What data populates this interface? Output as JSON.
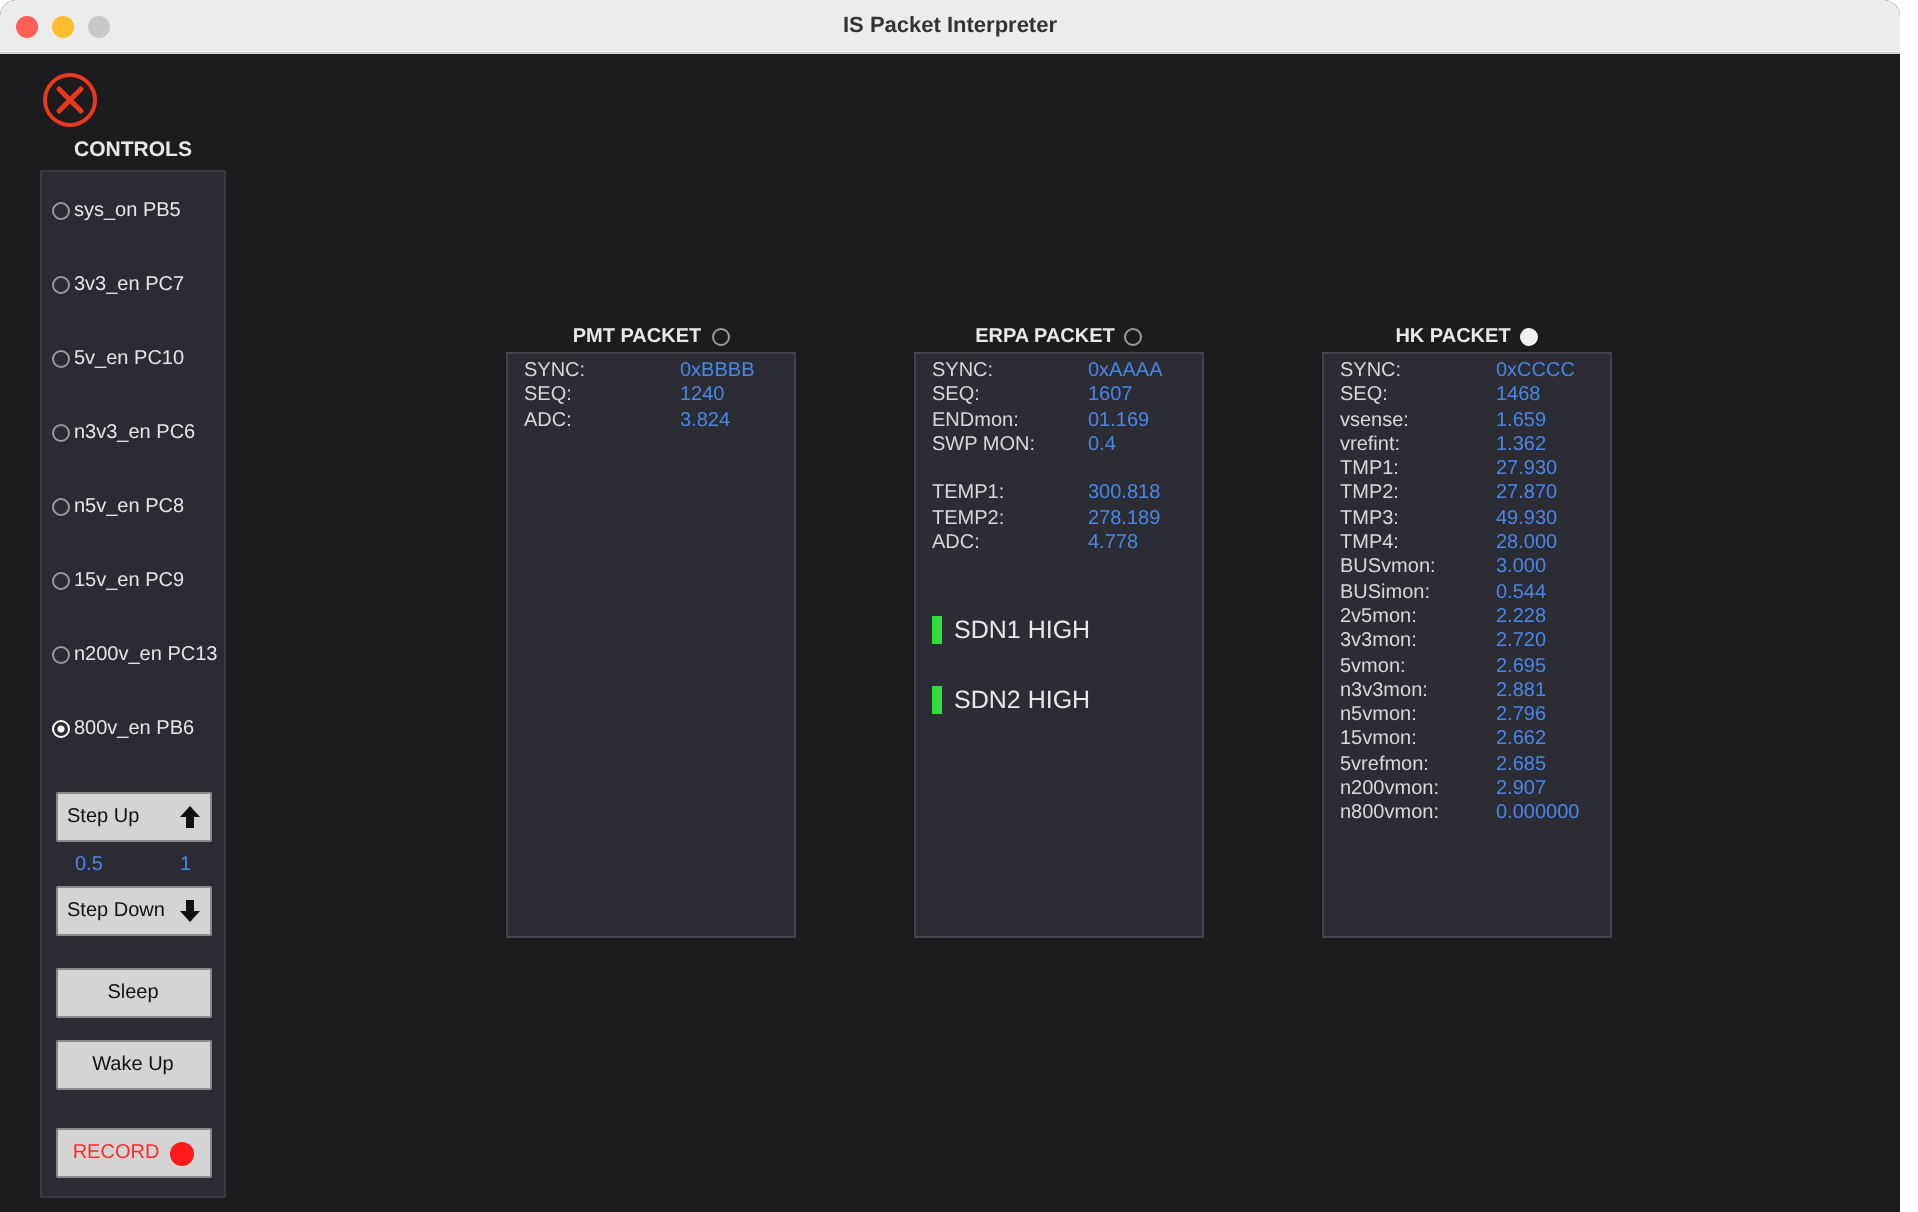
{
  "window": {
    "title": "IS Packet Interpreter"
  },
  "controls": {
    "title": "CONTROLS",
    "switches": [
      {
        "label": "sys_on PB5",
        "selected": false
      },
      {
        "label": "3v3_en PC7",
        "selected": false
      },
      {
        "label": "5v_en PC10",
        "selected": false
      },
      {
        "label": "n3v3_en PC6",
        "selected": false
      },
      {
        "label": "n5v_en PC8",
        "selected": false
      },
      {
        "label": "15v_en PC9",
        "selected": false
      },
      {
        "label": "n200v_en PC13",
        "selected": false
      },
      {
        "label": "800v_en PB6",
        "selected": true
      }
    ],
    "step_up": "Step Up",
    "step_value": "0.5",
    "step_limit": "1",
    "step_down": "Step Down",
    "sleep": "Sleep",
    "wake_up": "Wake Up",
    "record": "RECORD"
  },
  "packets": [
    {
      "title": "PMT PACKET",
      "on": false,
      "rows": [
        {
          "label": "SYNC:",
          "value": "0xBBBB",
          "gap_before": false
        },
        {
          "label": "SEQ:",
          "value": "1240",
          "gap_before": false
        },
        {
          "label": "ADC:",
          "value": "3.824",
          "gap_before": false
        }
      ]
    },
    {
      "title": "ERPA PACKET",
      "on": false,
      "rows": [
        {
          "label": "SYNC:",
          "value": "0xAAAA",
          "gap_before": false
        },
        {
          "label": "SEQ:",
          "value": "1607",
          "gap_before": false
        },
        {
          "label": "ENDmon:",
          "value": "01.169",
          "gap_before": false
        },
        {
          "label": "SWP MON:",
          "value": "0.4",
          "gap_before": false
        },
        {
          "label": "TEMP1:",
          "value": "300.818",
          "gap_before": true
        },
        {
          "label": "TEMP2:",
          "value": "278.189",
          "gap_before": false
        },
        {
          "label": "ADC:",
          "value": "4.778",
          "gap_before": false
        }
      ],
      "indicators": [
        {
          "label": "SDN1 HIGH",
          "on": true
        },
        {
          "label": "SDN2 HIGH",
          "on": true
        }
      ]
    },
    {
      "title": "HK PACKET",
      "on": true,
      "rows": [
        {
          "label": "SYNC:",
          "value": "0xCCCC",
          "gap_before": false
        },
        {
          "label": "SEQ:",
          "value": "1468",
          "gap_before": false
        },
        {
          "label": "vsense:",
          "value": "1.659",
          "gap_before": false
        },
        {
          "label": "vrefint:",
          "value": "1.362",
          "gap_before": false
        },
        {
          "label": "TMP1:",
          "value": "27.930",
          "gap_before": false
        },
        {
          "label": "TMP2:",
          "value": "27.870",
          "gap_before": false
        },
        {
          "label": "TMP3:",
          "value": "49.930",
          "gap_before": false
        },
        {
          "label": "TMP4:",
          "value": "28.000",
          "gap_before": false
        },
        {
          "label": "BUSvmon:",
          "value": "3.000",
          "gap_before": false
        },
        {
          "label": "BUSimon:",
          "value": "0.544",
          "gap_before": false
        },
        {
          "label": "2v5mon:",
          "value": "2.228",
          "gap_before": false
        },
        {
          "label": "3v3mon:",
          "value": "2.720",
          "gap_before": false
        },
        {
          "label": "5vmon:",
          "value": "2.695",
          "gap_before": false
        },
        {
          "label": "n3v3mon:",
          "value": "2.881",
          "gap_before": false
        },
        {
          "label": "n5vmon:",
          "value": "2.796",
          "gap_before": false
        },
        {
          "label": "15vmon:",
          "value": "2.662",
          "gap_before": false
        },
        {
          "label": "5vrefmon:",
          "value": "2.685",
          "gap_before": false
        },
        {
          "label": "n200vmon:",
          "value": "2.907",
          "gap_before": false
        },
        {
          "label": "n800vmon:",
          "value": "0.000000",
          "gap_before": false
        }
      ]
    }
  ]
}
